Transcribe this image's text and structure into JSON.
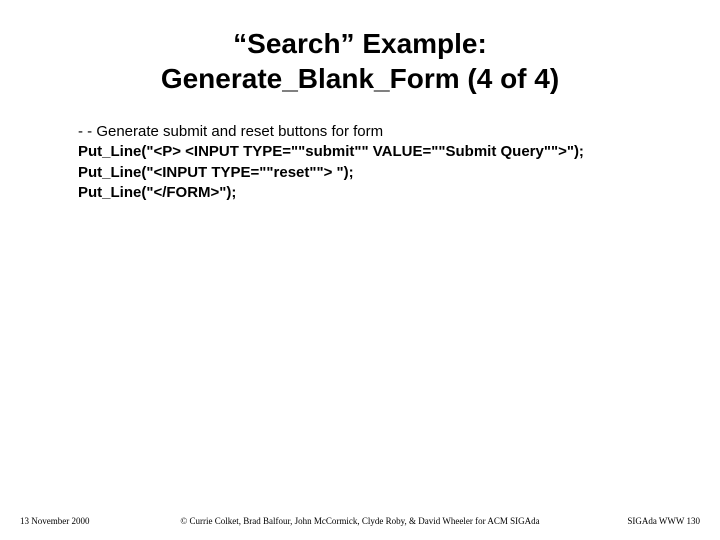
{
  "title_line1": "“Search” Example:",
  "title_line2": "Generate_Blank_Form (4 of 4)",
  "code": {
    "l1": "- - Generate submit and reset buttons for form",
    "l2": "Put_Line(\"<P> <INPUT TYPE=\"\"submit\"\" VALUE=\"\"Submit Query\"\">\");",
    "l3": "Put_Line(\"<INPUT TYPE=\"\"reset\"\"> \");",
    "l4": "Put_Line(\"</FORM>\");"
  },
  "footer": {
    "date": "13 November 2000",
    "right": "SIGAda WWW 130",
    "credit": "© Currie Colket, Brad Balfour, John McCormick, Clyde Roby, & David Wheeler for ACM SIGAda"
  }
}
